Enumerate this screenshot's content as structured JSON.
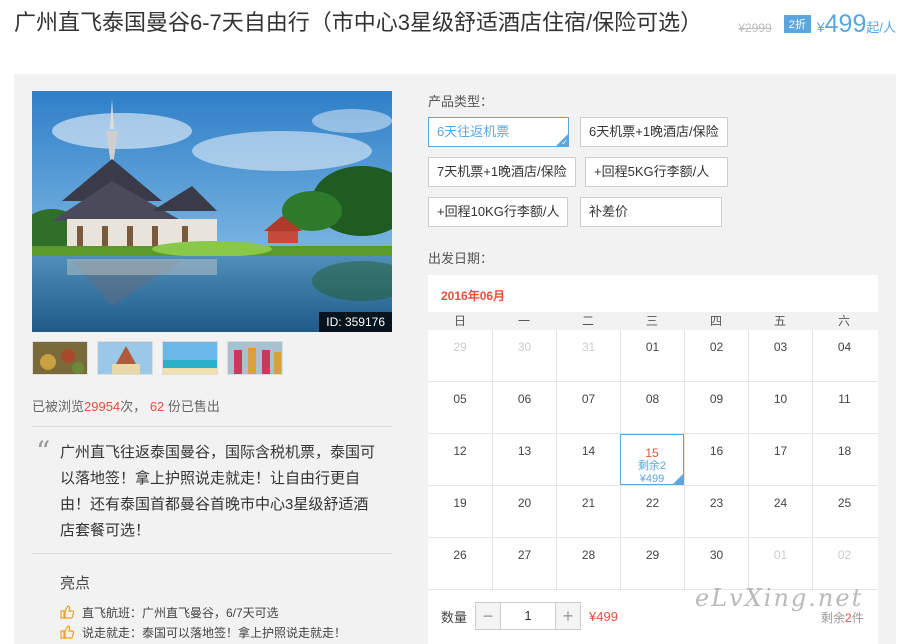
{
  "product": {
    "title": "广州直飞泰国曼谷6-7天自由行（市中心3星级舒适酒店住宿/保险可选）",
    "old_price": "¥2999",
    "discount": "2折",
    "currency": "¥",
    "price": "499",
    "unit": "起/人"
  },
  "gallery": {
    "image_id": "ID: 359176",
    "thumb_count": 4
  },
  "stats": {
    "prefix": "已被浏览",
    "views": "29954",
    "mid": "次，",
    "sold": "62",
    "suffix": "份已售出"
  },
  "quote": {
    "mark": "“",
    "text": "广州直飞往返泰国曼谷，国际含税机票，泰国可以落地签！拿上护照说走就走！让自由行更自由！还有泰国首都曼谷首晚市中心3星级舒适酒店套餐可选！"
  },
  "highlights": {
    "title": "亮点",
    "items": [
      "直飞航班：广州直飞曼谷，6/7天可选",
      "说走就走：泰国可以落地签！拿上护照说走就走！"
    ]
  },
  "product_type": {
    "label": "产品类型：",
    "options": [
      "6天往返机票",
      "6天机票+1晚酒店/保险",
      "7天机票+1晚酒店/保险",
      "+回程5KG行李额/人",
      "+回程10KG行李额/人",
      "补差价"
    ],
    "selected_index": 0
  },
  "departure": {
    "label": "出发日期：",
    "month": "2016年06月",
    "weekdays": [
      "日",
      "一",
      "二",
      "三",
      "四",
      "五",
      "六"
    ],
    "weeks": [
      [
        "29",
        "30",
        "31",
        "01",
        "02",
        "03",
        "04"
      ],
      [
        "05",
        "06",
        "07",
        "08",
        "09",
        "10",
        "11"
      ],
      [
        "12",
        "13",
        "14",
        "15",
        "16",
        "17",
        "18"
      ],
      [
        "19",
        "20",
        "21",
        "22",
        "23",
        "24",
        "25"
      ],
      [
        "26",
        "27",
        "28",
        "29",
        "30",
        "01",
        "02"
      ]
    ],
    "selected": {
      "day": "15",
      "remaining": "剩余2",
      "price": "¥499"
    }
  },
  "quantity": {
    "label": "数量",
    "minus": "−",
    "value": "1",
    "plus": "+",
    "price": "¥499",
    "remain_prefix": "剩余",
    "remain_count": "2",
    "remain_suffix": "件"
  },
  "watermark": "eLvXing.net",
  "colors": {
    "accent": "#5aa7e0",
    "red": "#e94e40"
  }
}
